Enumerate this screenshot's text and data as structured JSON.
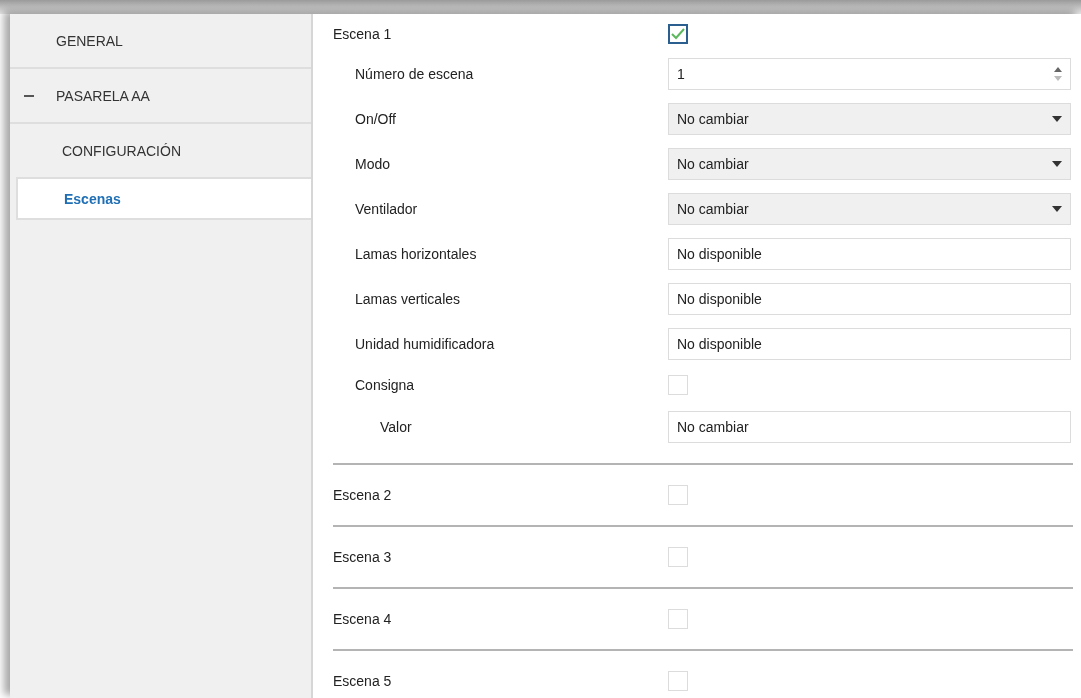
{
  "sidebar": {
    "items": [
      {
        "label": "GENERAL",
        "kind": "item",
        "selected": false
      },
      {
        "label": "PASARELA AA",
        "kind": "group",
        "expanded": true,
        "children": [
          {
            "label": "CONFIGURACIÓN",
            "selected": false
          },
          {
            "label": "Escenas",
            "selected": true
          }
        ]
      }
    ]
  },
  "scenes": [
    {
      "label": "Escena 1",
      "checked": true,
      "fields": [
        {
          "label": "Número de escena",
          "kind": "spin",
          "value": "1"
        },
        {
          "label": "On/Off",
          "kind": "select",
          "value": "No cambiar"
        },
        {
          "label": "Modo",
          "kind": "select",
          "value": "No cambiar"
        },
        {
          "label": "Ventilador",
          "kind": "select",
          "value": "No cambiar"
        },
        {
          "label": "Lamas horizontales",
          "kind": "text",
          "value": "No disponible"
        },
        {
          "label": "Lamas verticales",
          "kind": "text",
          "value": "No disponible"
        },
        {
          "label": "Unidad humidificadora",
          "kind": "text",
          "value": "No disponible"
        },
        {
          "label": "Consigna",
          "kind": "checkbox",
          "checked": false,
          "children": [
            {
              "label": "Valor",
              "kind": "text",
              "value": "No cambiar"
            }
          ]
        }
      ]
    },
    {
      "label": "Escena 2",
      "checked": false
    },
    {
      "label": "Escena 3",
      "checked": false
    },
    {
      "label": "Escena 4",
      "checked": false
    },
    {
      "label": "Escena 5",
      "checked": false
    }
  ]
}
